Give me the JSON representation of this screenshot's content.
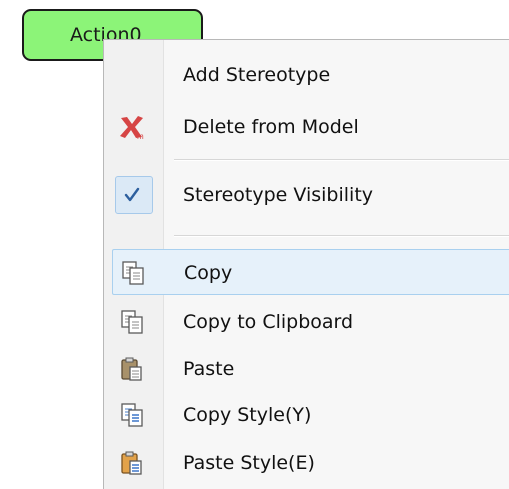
{
  "diagram": {
    "action_node_label": "Action0",
    "node_fill_color": "#8cf478"
  },
  "context_menu": {
    "items": [
      {
        "label": "Add Stereotype",
        "icon": null
      },
      {
        "label": "Delete from Model",
        "icon": "delete-cross-icon"
      },
      {
        "label": "Stereotype Visibility",
        "icon": "checkmark-icon",
        "checked": true
      },
      {
        "label": "Copy",
        "icon": "copy-icon",
        "highlighted": true
      },
      {
        "label": "Copy to Clipboard",
        "icon": "copy-clipboard-icon"
      },
      {
        "label": "Paste",
        "icon": "paste-icon"
      },
      {
        "label": "Copy Style(Y)",
        "icon": "copy-style-icon"
      },
      {
        "label": "Paste Style(E)",
        "icon": "paste-style-icon"
      }
    ],
    "highlight_color": "#e6f1fa",
    "delete_icon_color": "#d64545"
  }
}
